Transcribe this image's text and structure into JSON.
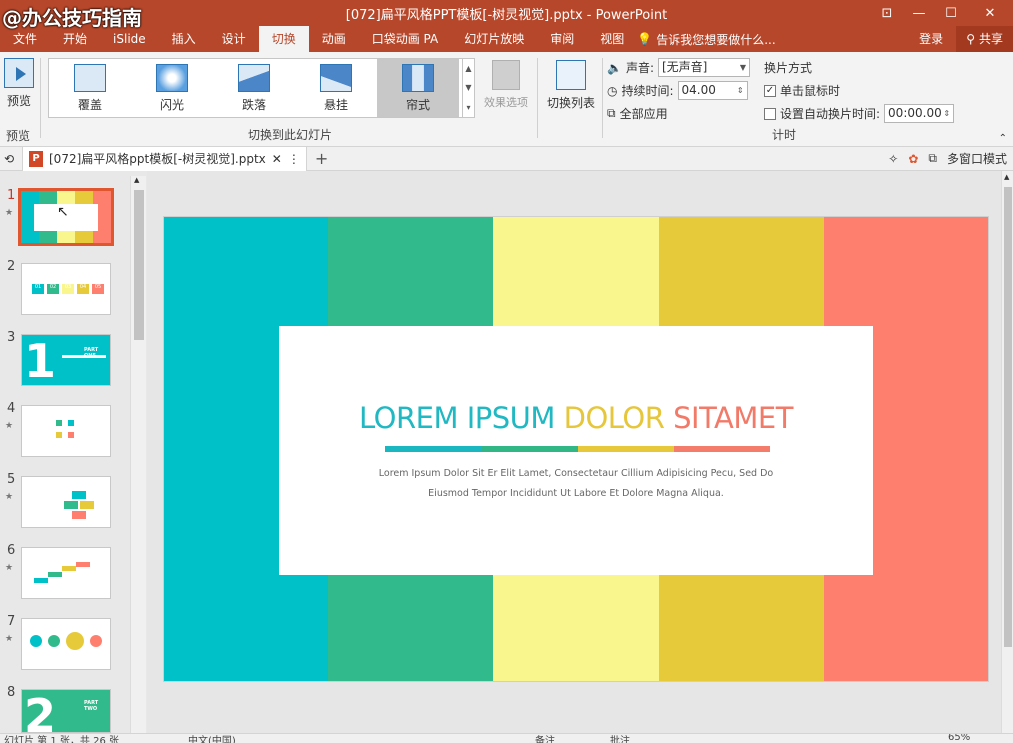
{
  "watermark": "@办公技巧指南",
  "window": {
    "title": "[072]扁平风格PPT模板[-树灵视觉].pptx - PowerPoint"
  },
  "menu": {
    "items": [
      "文件",
      "开始",
      "iSlide",
      "插入",
      "设计",
      "切换",
      "动画",
      "口袋动画 PA",
      "幻灯片放映",
      "审阅",
      "视图"
    ],
    "active": "切换",
    "tellme": "告诉我您想要做什么...",
    "login": "登录",
    "share": "共享"
  },
  "ribbon": {
    "preview_label": "预览",
    "preview_group": "预览",
    "gallery_items": [
      "覆盖",
      "闪光",
      "跌落",
      "悬挂",
      "帘式"
    ],
    "gallery_selected": "帘式",
    "gallery_group": "切换到此幻灯片",
    "effect_options": "效果选项",
    "transition_list": "切换列表",
    "sound_label": "声音:",
    "sound_value": "[无声音]",
    "duration_label": "持续时间:",
    "duration_value": "04.00",
    "apply_all": "全部应用",
    "advance_title": "换片方式",
    "on_click": "单击鼠标时",
    "on_click_checked": true,
    "auto_after": "设置自动换片时间:",
    "auto_value": "00:00.00",
    "timing_group": "计时"
  },
  "doc": {
    "tab": "[072]扁平风格ppt模板[-树灵视觉].pptx",
    "multiwindow": "多窗口模式"
  },
  "thumbnails": [
    "1",
    "2",
    "3",
    "4",
    "5",
    "6",
    "7",
    "8"
  ],
  "thumb_texts": {
    "t2_nums": [
      "01",
      "02",
      "03",
      "04",
      "05"
    ],
    "t3": "PART ONE",
    "t8": "PART TWO"
  },
  "slide": {
    "title_words": [
      {
        "text": "LOREM",
        "color": "#20b8c2"
      },
      {
        "text": "IPSUM",
        "color": "#20b8c2"
      },
      {
        "text": "DOLOR",
        "color": "#e6c63a"
      },
      {
        "text": "SITAMET",
        "color": "#f27a68"
      }
    ],
    "subtitle_line1": "Lorem Ipsum Dolor Sit Er Elit Lamet, Consectetaur Cillium Adipisicing Pecu, Sed Do",
    "subtitle_line2": "Eiusmod Tempor Incididunt Ut Labore Et Dolore Magna Aliqua.",
    "stripe_colors": [
      "#00c0c8",
      "#31bb8c",
      "#f8f68c",
      "#e6ca3a",
      "#fe7f6e"
    ],
    "bar_colors": [
      "#1ab7c0",
      "#31b786",
      "#e6c83a",
      "#f47c6b"
    ]
  },
  "status": {
    "slide_info": "幻灯片 第 1 张，共 26 张",
    "language": "中文(中国)",
    "notes": "备注",
    "comments": "批注",
    "zoom": "65%"
  }
}
